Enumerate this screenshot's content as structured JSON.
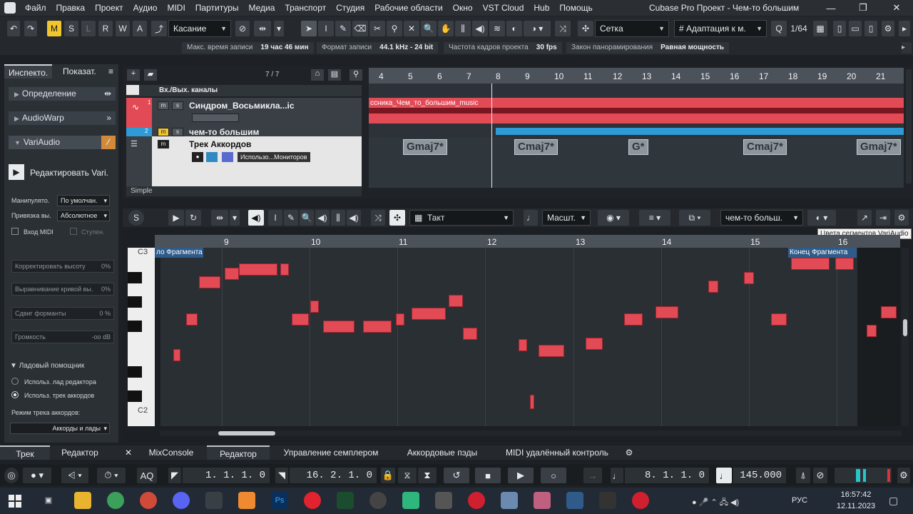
{
  "menubar": {
    "items": [
      "Файл",
      "Правка",
      "Проект",
      "Аудио",
      "MIDI",
      "Партитуры",
      "Медиа",
      "Транспорт",
      "Студия",
      "Рабочие области",
      "Окно",
      "VST Cloud",
      "Hub",
      "Помощь"
    ],
    "window_title": "Cubase Pro Проект - Чем-то большим"
  },
  "toolbar": {
    "mode_buttons": [
      "M",
      "S",
      "L",
      "R",
      "W",
      "A"
    ],
    "touch_mode": "Касание",
    "grid_label": "Сетка",
    "adapt_label": "Адаптация к м.",
    "quantize_value": "1/64"
  },
  "infobar": {
    "max_rec_label": "Макс. время записи",
    "max_rec_value": "19 час 46 мин",
    "rec_format_label": "Формат записи",
    "rec_format_value": "44.1 kHz - 24 bit",
    "frame_rate_label": "Частота кадров проекта",
    "frame_rate_value": "30 fps",
    "pan_law_label": "Закон панорамирования",
    "pan_law_value": "Равная мощность"
  },
  "inspector": {
    "tab_inspector": "Инспекто.",
    "tab_visibility": "Показат.",
    "sections": [
      "Определение",
      "AudioWarp",
      "VariAudio"
    ],
    "edit_vari_label": "Редактировать Vari.",
    "manipulator_label": "Манипулято.",
    "manipulator_value": "По умолчан.",
    "snap_label": "Привязка вы.",
    "snap_value": "Абсолютное",
    "midi_input_label": "Вход MIDI",
    "steps_label": "Ступен.",
    "pitch_correct_label": "Корректировать высоту",
    "pitch_correct_value": "0%",
    "flatten_label": "Выравнивание кривой вы.",
    "flatten_value": "0%",
    "formant_label": "Сдвиг форманты",
    "formant_value": "0 %",
    "volume_label": "Громкость",
    "volume_value": "-oo dB",
    "scale_assistant_label": "Ладовый помощник",
    "use_editor_scale_label": "Использ. лад редактора",
    "use_chord_track_label": "Использ. трек аккордов",
    "chord_mode_label": "Режим трека аккордов:",
    "chord_mode_value": "Аккорды и лады"
  },
  "project": {
    "track_count": "7 / 7",
    "io_label": "Вх./Вых. каналы",
    "tracks": [
      {
        "name": "Синдром_Восьмикла...ic",
        "number": "1"
      },
      {
        "name": "чем-то большим",
        "number": "2"
      },
      {
        "name": "Трек Аккордов",
        "extra": "Использо...Мониторов"
      }
    ],
    "footer_label": "Simple",
    "ruler": [
      "4",
      "5",
      "6",
      "7",
      "8",
      "9",
      "10",
      "11",
      "12",
      "13",
      "14",
      "15",
      "16",
      "17",
      "18",
      "19",
      "20",
      "21"
    ],
    "clip_name": "ссника_Чем_то_большим_music",
    "chords": [
      "Gmaj7*",
      "Cmaj7*",
      "G*",
      "Cmaj7*",
      "Gmaj7*"
    ]
  },
  "editor": {
    "quantize_label": "Такт",
    "scale_label": "Масшт.",
    "track_label": "чем-то больш.",
    "tooltip": "Цвета сегментов VariAudio",
    "ruler": [
      "9",
      "10",
      "11",
      "12",
      "13",
      "14",
      "15",
      "16"
    ],
    "fragment_start": "ло Фрагмента",
    "fragment_end": "Конец Фрагмента",
    "key_top": "C3",
    "key_bottom": "C2"
  },
  "bottom_tabs": {
    "left": [
      "Трек",
      "Редактор"
    ],
    "right": [
      "MixConsole",
      "Редактор",
      "Управление семплером",
      "Аккордовые пэды",
      "MIDI удалённый контроль"
    ]
  },
  "transport": {
    "left_locator": "1. 1. 1.   0",
    "right_locator": "16. 2. 1.   0",
    "position": "8. 1. 1.   0",
    "tempo": "145.000"
  },
  "taskbar": {
    "lang": "РУС",
    "time": "16:57:42",
    "date": "12.11.2023"
  },
  "colors": {
    "accent_yellow": "#f0c530",
    "audio_red": "#e24a55",
    "track_blue": "#2e9ad6"
  }
}
